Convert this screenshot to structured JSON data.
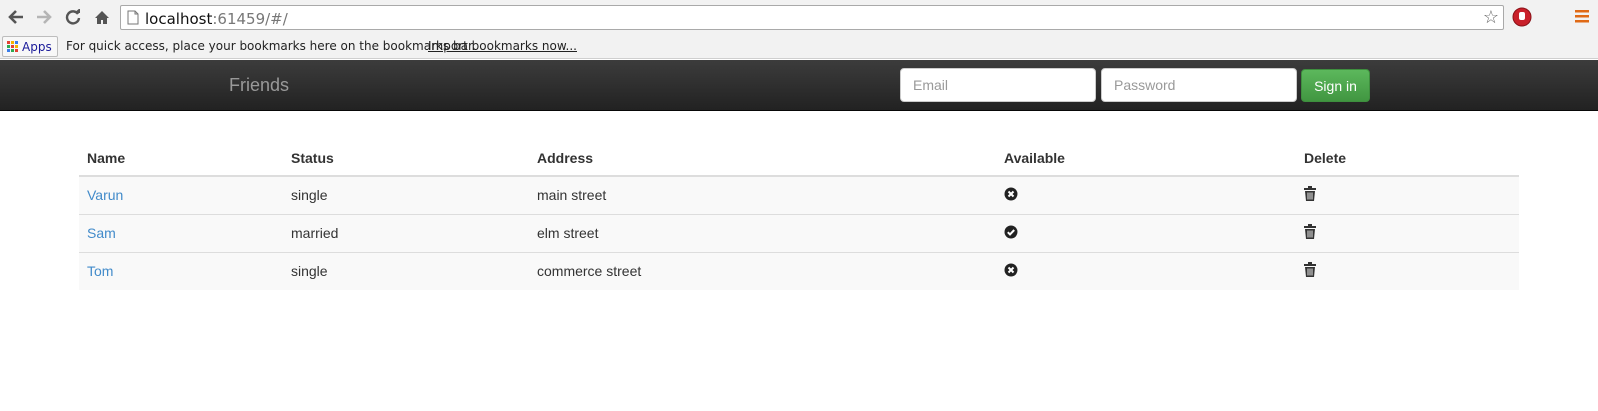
{
  "browser": {
    "url_host": "localhost",
    "url_rest": ":61459/#/",
    "bookmarks": {
      "apps_label": "Apps",
      "hint_text": "For quick access, place your bookmarks here on the bookmarks bar.",
      "import_link": "Import bookmarks now..."
    }
  },
  "navbar": {
    "brand": "Friends",
    "email_placeholder": "Email",
    "password_placeholder": "Password",
    "signin_label": "Sign in"
  },
  "table": {
    "headers": {
      "name": "Name",
      "status": "Status",
      "address": "Address",
      "available": "Available",
      "delete": "Delete"
    },
    "rows": [
      {
        "name": "Varun",
        "status": "single",
        "address": "main street",
        "available_icon": "remove-circle-icon"
      },
      {
        "name": "Sam",
        "status": "married",
        "address": "elm street",
        "available_icon": "ok-circle-icon"
      },
      {
        "name": "Tom",
        "status": "single",
        "address": "commerce street",
        "available_icon": "remove-circle-icon"
      }
    ],
    "delete_icon": "trash-icon"
  },
  "colors": {
    "link": "#428bca",
    "signin": "#5cb85c",
    "navbar": "#222222"
  }
}
